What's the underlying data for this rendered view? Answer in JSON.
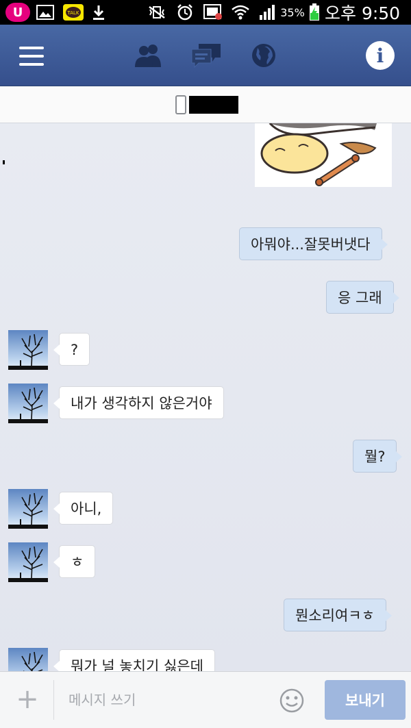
{
  "status_bar": {
    "carrier_badge": "U",
    "kakao_label": "TALK",
    "battery_percent": "35%",
    "time": "오후 9:50"
  },
  "app_bar": {
    "icons": [
      "menu-icon",
      "friends-icon",
      "messages-icon",
      "globe-icon",
      "info-icon"
    ],
    "info_glyph": "i"
  },
  "conversation": {
    "messages": [
      {
        "from": "me",
        "text": "아뭐야...잘못버냇다"
      },
      {
        "from": "me",
        "text": "응 그래"
      },
      {
        "from": "them",
        "text": "?"
      },
      {
        "from": "them",
        "text": "내가 생각하지 않은거야"
      },
      {
        "from": "me",
        "text": "뭘?"
      },
      {
        "from": "them",
        "text": "아니,"
      },
      {
        "from": "them",
        "text": "ㅎ"
      },
      {
        "from": "me",
        "text": "뭔소리여ㅋㅎ"
      },
      {
        "from": "them",
        "text": "뭐가 널 놓치기 싫은데"
      }
    ]
  },
  "composer": {
    "placeholder": "메시지 쓰기",
    "send_label": "보내기",
    "add_glyph": "+"
  },
  "colors": {
    "app_bar": "#3b5998",
    "my_bubble": "#d4e3f5",
    "their_bubble": "#ffffff",
    "send_button": "#9fb7de"
  }
}
